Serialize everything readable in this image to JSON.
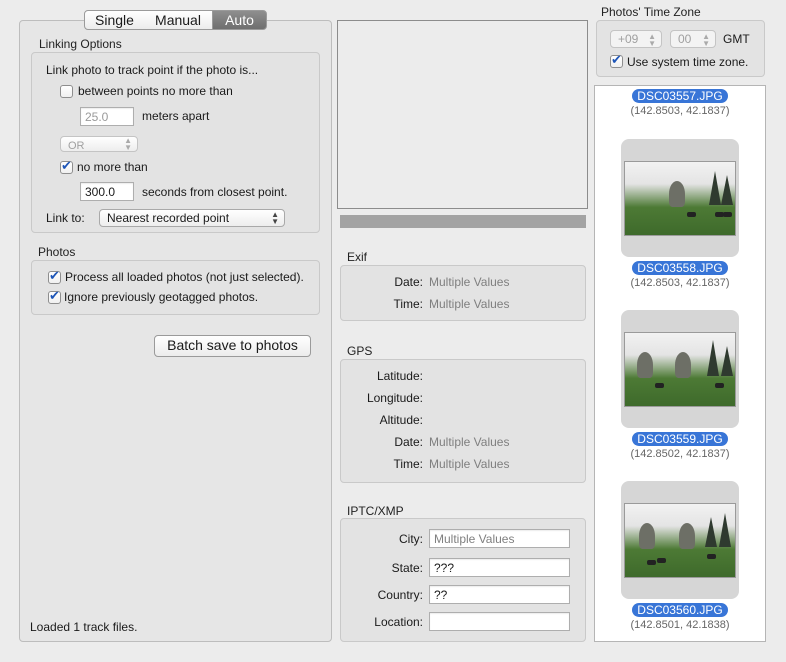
{
  "tabs": [
    {
      "label": "Single",
      "selected": false
    },
    {
      "label": "Manual",
      "selected": false
    },
    {
      "label": "Auto",
      "selected": true
    }
  ],
  "linking": {
    "title": "Linking Options",
    "intro": "Link photo to track point if the photo is...",
    "between_label": "between points no more than",
    "between_checked": false,
    "meters_value": "25.0",
    "meters_label": "meters apart",
    "logic_value": "OR",
    "no_more_label": "no more than",
    "no_more_checked": true,
    "seconds_value": "300.0",
    "seconds_label": "seconds from closest point.",
    "link_to_label": "Link to:",
    "link_to_value": "Nearest recorded point"
  },
  "photos_group": {
    "title": "Photos",
    "process_all_label": "Process all loaded photos (not just selected).",
    "process_all_checked": true,
    "ignore_label": "Ignore previously geotagged photos.",
    "ignore_checked": true
  },
  "batch_button": "Batch save to photos",
  "status": "Loaded 1 track files.",
  "exif": {
    "title": "Exif",
    "date_label": "Date:",
    "date_value": "Multiple Values",
    "time_label": "Time:",
    "time_value": "Multiple Values"
  },
  "gps": {
    "title": "GPS",
    "latitude_label": "Latitude:",
    "longitude_label": "Longitude:",
    "altitude_label": "Altitude:",
    "date_label": "Date:",
    "date_value": "Multiple Values",
    "time_label": "Time:",
    "time_value": "Multiple Values"
  },
  "iptc": {
    "title": "IPTC/XMP",
    "city_label": "City:",
    "city_placeholder": "Multiple Values",
    "state_label": "State:",
    "state_value": "???",
    "country_label": "Country:",
    "country_value": "??",
    "location_label": "Location:",
    "location_value": ""
  },
  "timezone": {
    "title": "Photos' Time Zone",
    "hours": "+09",
    "minutes": "00",
    "gmt_label": "GMT",
    "use_system_label": "Use system time zone.",
    "use_system_checked": true
  },
  "photos": [
    {
      "name": "DSC03557.JPG",
      "coords": "(142.8503, 42.1837)"
    },
    {
      "name": "DSC03558.JPG",
      "coords": "(142.8503, 42.1837)"
    },
    {
      "name": "DSC03559.JPG",
      "coords": "(142.8502, 42.1837)"
    },
    {
      "name": "DSC03560.JPG",
      "coords": "(142.8501, 42.1838)"
    }
  ],
  "colors": {
    "selection": "#3875d7",
    "window_bg": "#ececec"
  }
}
